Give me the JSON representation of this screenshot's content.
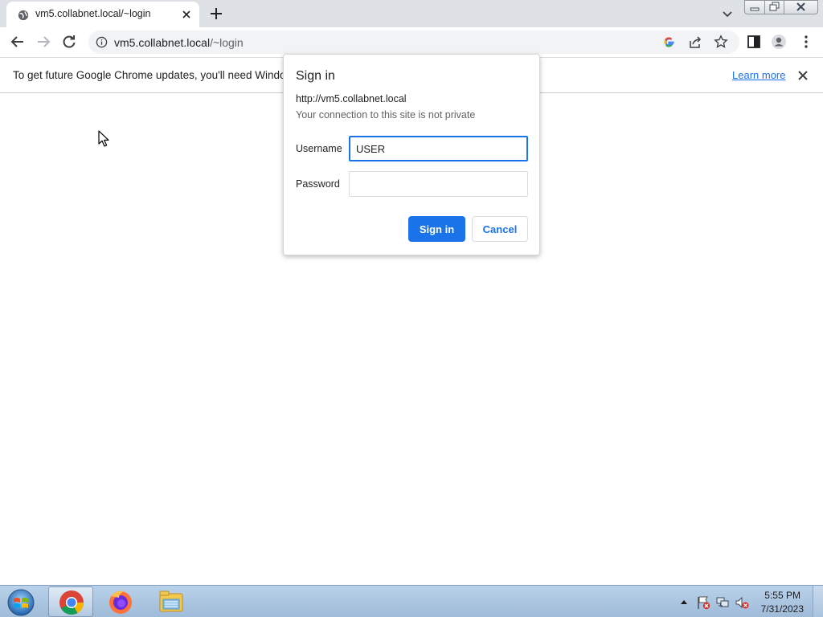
{
  "browser": {
    "tab": {
      "title": "vm5.collabnet.local/~login"
    },
    "address_bar": {
      "url_host": "vm5.collabnet.local",
      "url_path": "/~login"
    },
    "accent_color": "#1a73e8"
  },
  "infobar": {
    "message": "To get future Google Chrome updates, you'll need Window",
    "link": "Learn more"
  },
  "dialog": {
    "title": "Sign in",
    "origin": "http://vm5.collabnet.local",
    "subtitle": "Your connection to this site is not private",
    "username_label": "Username",
    "username_value": "USER",
    "password_label": "Password",
    "password_value": "",
    "sign_in_button": "Sign in",
    "cancel_button": "Cancel"
  },
  "taskbar": {
    "apps": [
      "chrome-icon",
      "firefox-icon",
      "file-explorer-icon"
    ],
    "clock": {
      "time": "5:55 PM",
      "date": "7/31/2023"
    }
  }
}
